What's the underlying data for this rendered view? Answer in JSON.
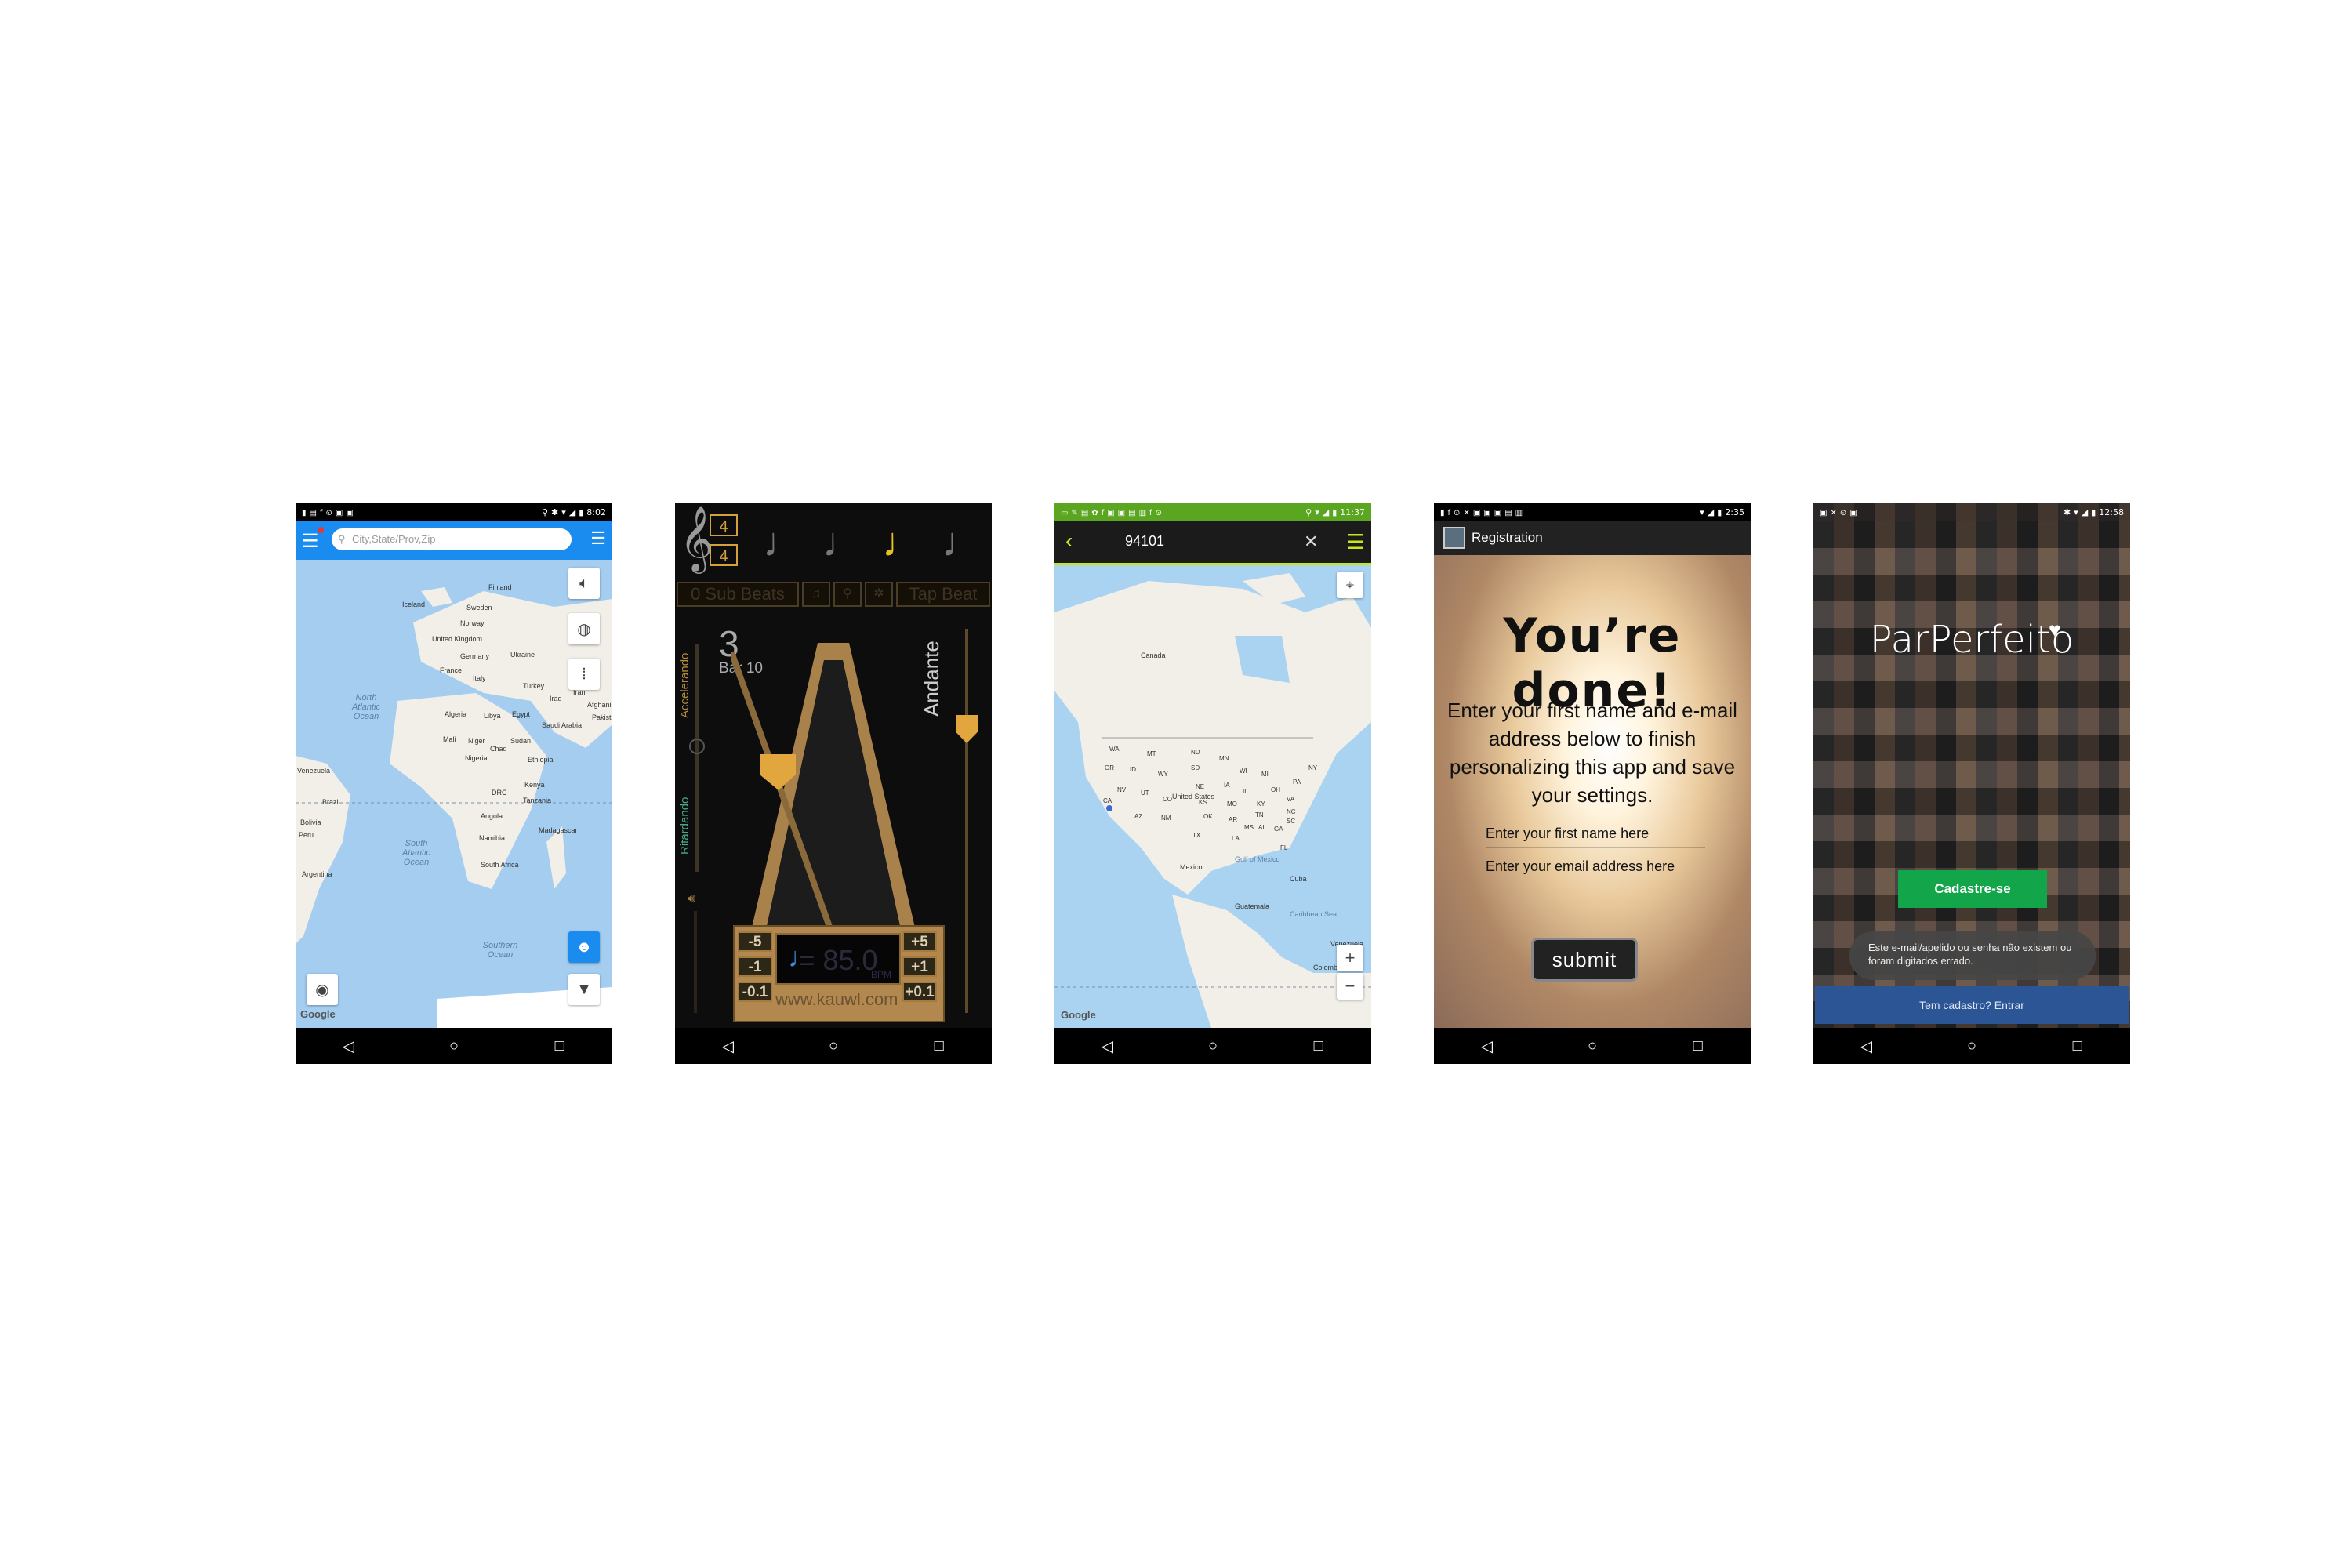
{
  "phone1": {
    "status": {
      "time": "8:02"
    },
    "search": {
      "placeholder": "City,State/Prov,Zip"
    },
    "map_labels": {
      "north_atlantic": "North Atlantic Ocean",
      "south_atlantic": "South Atlantic Ocean",
      "southern": "Southern Ocean"
    },
    "land_labels": [
      "Iceland",
      "Finland",
      "Sweden",
      "Norway",
      "United Kingdom",
      "Germany",
      "Ukraine",
      "France",
      "Italy",
      "Turkey",
      "Iraq",
      "Iran",
      "Afghanistan",
      "Pakistan",
      "Algeria",
      "Libya",
      "Egypt",
      "Saudi Arabia",
      "Mali",
      "Niger",
      "Sudan",
      "Chad",
      "Nigeria",
      "Ethiopia",
      "Kenya",
      "DRC",
      "Tanzania",
      "Angola",
      "Namibia",
      "Madagascar",
      "South Africa",
      "Venezuela",
      "Brazil",
      "Bolivia",
      "Peru",
      "Argentina"
    ],
    "google": "Google",
    "icons": {
      "sound": "speaker-icon",
      "globe": "globe-icon",
      "traffic": "traffic-light-icon",
      "person": "person-icon",
      "filter": "filter-icon",
      "lens": "lens-icon"
    }
  },
  "phone2": {
    "time_sig_top": "4",
    "time_sig_bottom": "4",
    "tools": {
      "sub_beats": "0 Sub Beats",
      "tap_beat": "Tap Beat"
    },
    "beat": "3",
    "bar": "Bar 10",
    "accelerando": "Accelerando",
    "ritardando": "Ritardando",
    "tempo_name": "Andante",
    "bpm_value": "85.0",
    "bpm_unit": "BPM",
    "buttons": {
      "minus5": "-5",
      "minus1": "-1",
      "minus01": "-0.1",
      "plus5": "+5",
      "plus1": "+1",
      "plus01": "+0.1"
    },
    "website": "www.kauwl.com"
  },
  "phone3": {
    "status": {
      "time": "11:37"
    },
    "search_value": "94101",
    "countries": [
      "Canada",
      "United States",
      "Mexico",
      "Gulf of Mexico",
      "Cuba",
      "Caribbean Sea",
      "Guatemala",
      "Venezuela",
      "Colombia"
    ],
    "states": [
      "WA",
      "MT",
      "ND",
      "MN",
      "OR",
      "ID",
      "WY",
      "SD",
      "WI",
      "MI",
      "NY",
      "NV",
      "UT",
      "CO",
      "NE",
      "IA",
      "IL",
      "OH",
      "PA",
      "CA",
      "KS",
      "MO",
      "KY",
      "VA",
      "AZ",
      "NM",
      "OK",
      "AR",
      "TN",
      "NC",
      "TX",
      "LA",
      "MS",
      "AL",
      "GA",
      "SC",
      "FL"
    ],
    "google": "Google",
    "zoom_in": "+",
    "zoom_out": "−"
  },
  "phone4": {
    "status": {
      "time": "2:35"
    },
    "header_title": "Registration",
    "headline": "You’re done!",
    "message": "Enter your first name and e-mail address below to finish personalizing this app and save your settings.",
    "first_name_placeholder": "Enter your first name here",
    "email_placeholder": "Enter your email address here",
    "submit": "submit"
  },
  "phone5": {
    "status": {
      "time": "12:58"
    },
    "logo": "ParPerfeito",
    "cta": "Cadastre-se",
    "toast": "Este e-mail/apelido ou senha não existem ou foram digitados errado.",
    "login": "Tem cadastro? Entrar"
  }
}
